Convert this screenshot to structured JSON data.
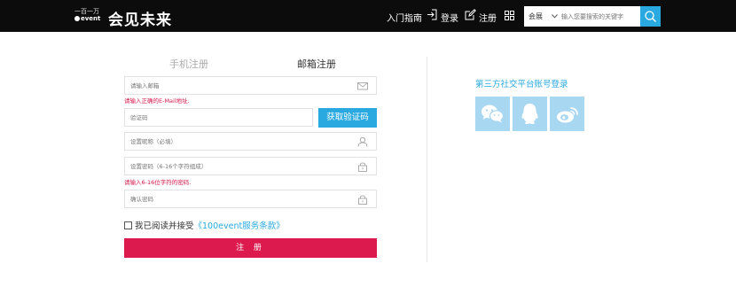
{
  "header": {
    "logo_line1": "一百一万",
    "logo_line2": "event",
    "logo_text": "会见未来",
    "nav": {
      "guide": "入门指南",
      "login": "登录",
      "register": "注册"
    },
    "search": {
      "category": "会展",
      "placeholder": "输入您要搜索的关键字"
    }
  },
  "form": {
    "tabs": {
      "phone": "手机注册",
      "email": "邮箱注册"
    },
    "email_placeholder": "请输入邮箱",
    "email_error": "请输入正确的E-Mail地址.",
    "code_placeholder": "验证码",
    "get_code_label": "获取验证码",
    "nickname_placeholder": "设置昵称（必填）",
    "password_placeholder": "设置密码（6-16个字符组成）",
    "password_error": "请输入6-16位字符的密码.",
    "confirm_placeholder": "确认密码",
    "agree_prefix": "我已阅读并接受",
    "agree_link": "《100event服务条款》",
    "submit_label": "注 册"
  },
  "social": {
    "title": "第三方社交平台账号登录",
    "providers": [
      "wechat-icon",
      "qq-icon",
      "weibo-icon"
    ]
  },
  "colors": {
    "accent": "#29a9e0",
    "danger": "#dc1a4e",
    "header_bg": "#0c0c0c",
    "social_tile": "#a8d7f1"
  }
}
